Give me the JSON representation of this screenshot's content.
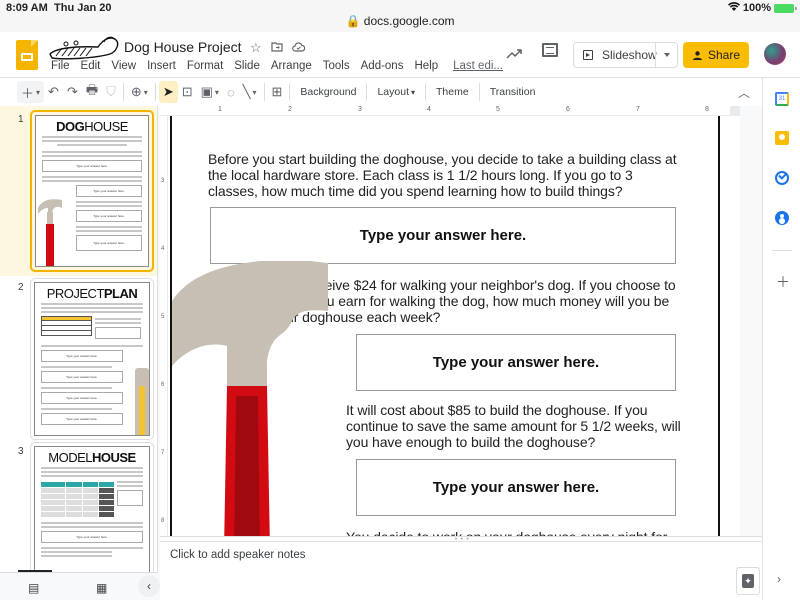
{
  "status_bar": {
    "time": "8:09 AM",
    "date": "Thu Jan 20",
    "url": "docs.google.com",
    "battery": "100%"
  },
  "header": {
    "doc_title": "Dog House Project",
    "title_icons": [
      "star-icon",
      "move-to-folder-icon",
      "cloud-saved-icon"
    ],
    "menu": [
      "File",
      "Edit",
      "View",
      "Insert",
      "Format",
      "Slide",
      "Arrange",
      "Tools",
      "Add-ons",
      "Help"
    ],
    "last_edit": "Last edi...",
    "slideshow_label": "Slideshow",
    "share_label": "Share",
    "colors": {
      "share": "#fbbc04",
      "slides_logo": "#f4b400"
    }
  },
  "toolbar": {
    "background_label": "Background",
    "layout_label": "Layout",
    "theme_label": "Theme",
    "transition_label": "Transition"
  },
  "ruler": {
    "h_marks": [
      "1",
      "2",
      "3",
      "4",
      "5",
      "6",
      "7",
      "8"
    ],
    "v_marks": [
      "3",
      "4",
      "5",
      "6",
      "7",
      "8"
    ]
  },
  "filmstrip": {
    "slides": [
      {
        "number": "1",
        "title_bold": "DOG",
        "title_light": "HOUSE",
        "selected": true,
        "answer_label": "Type your answer here."
      },
      {
        "number": "2",
        "title_light": "PROJECT",
        "title_bold": "PLAN",
        "selected": false,
        "table_header": "Puppy's Measurements",
        "table_rows": [
          "Length",
          "Height",
          "Shoulder Width"
        ],
        "answer_label": "Type your answer here."
      },
      {
        "number": "3",
        "title_light": "MODEL",
        "title_bold": "HOUSE",
        "selected": false,
        "answer_label": "Type your answer here."
      }
    ]
  },
  "slide": {
    "questions": [
      {
        "text": "Before you start building the doghouse, you decide to take a building class at the local hardware store. Each class is 1 1/2 hours long. If you go to 3 classes, how much time did you spend learning how to build things?",
        "answer_placeholder": "Type your answer here."
      },
      {
        "text": "Each week you receive $24 for walking your neighbor's dog. If you choose to save 2/3 of what you earn for walking the dog, how much money will you be saving for your doghouse each week?",
        "answer_placeholder": "Type your answer here."
      },
      {
        "text": "It will cost about $85 to build the doghouse. If you continue to save the same amount for 5 1/2 weeks, will you have enough to build the doghouse?",
        "answer_placeholder": "Type your answer here."
      },
      {
        "text": "You decide to work on your doghouse every night for"
      }
    ],
    "colors": {
      "hammer_head": "#c8bfb4",
      "hammer_handle": "#d20a11",
      "hammer_handle_dark": "#a00a0e"
    }
  },
  "notes": {
    "placeholder": "Click to add speaker notes"
  },
  "side_panel": {
    "calendar_day": "31"
  }
}
